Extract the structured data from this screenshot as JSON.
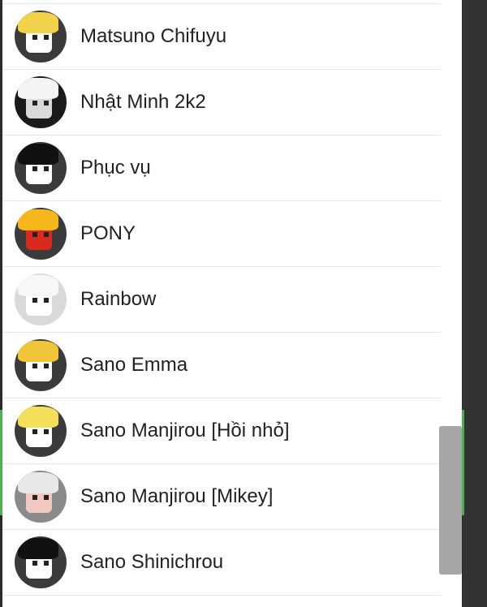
{
  "contacts": [
    {
      "name": "Matsuno Chifuyu",
      "avatar": {
        "icon": "avatar-blonde-icon",
        "hair": "#f2d24a",
        "face": "#ffffff",
        "bg": "#3b3b3b"
      }
    },
    {
      "name": "Nhật Minh 2k2",
      "avatar": {
        "icon": "avatar-monochrome-icon",
        "hair": "#f4f4f4",
        "face": "#d9d9d9",
        "bg": "#1a1a1a"
      }
    },
    {
      "name": "Phục vụ",
      "avatar": {
        "icon": "avatar-dark-hair-icon",
        "hair": "#111111",
        "face": "#ffffff",
        "bg": "#3b3b3b"
      }
    },
    {
      "name": "PONY",
      "avatar": {
        "icon": "avatar-red-pony-icon",
        "hair": "#f5b71c",
        "face": "#d82b1e",
        "bg": "#3b3b3b"
      }
    },
    {
      "name": "Rainbow",
      "avatar": {
        "icon": "avatar-white-red-eye-icon",
        "hair": "#f7f7f7",
        "face": "#ffffff",
        "bg": "#d9d9d9"
      }
    },
    {
      "name": "Sano Emma",
      "avatar": {
        "icon": "avatar-blonde-girl-icon",
        "hair": "#f0c53a",
        "face": "#ffffff",
        "bg": "#3b3b3b"
      }
    },
    {
      "name": "Sano Manjirou [Hồi nhỏ]",
      "avatar": {
        "icon": "avatar-spiky-blonde-icon",
        "hair": "#f4df5a",
        "face": "#ffffff",
        "bg": "#3b3b3b"
      }
    },
    {
      "name": "Sano Manjirou [Mikey]",
      "avatar": {
        "icon": "avatar-silver-hair-icon",
        "hair": "#e8e8e8",
        "face": "#f1c7c0",
        "bg": "#8a8a8a"
      }
    },
    {
      "name": "Sano Shinichrou",
      "avatar": {
        "icon": "avatar-black-hair-icon",
        "hair": "#111111",
        "face": "#ffffff",
        "bg": "#3b3b3b"
      }
    }
  ],
  "colors": {
    "panel_bg": "#ffffff",
    "divider": "#e6e6e6",
    "scrollbar": "#a6a6a6",
    "side_accent": "#4caf50",
    "outer_bg": "#2b2b2b"
  }
}
